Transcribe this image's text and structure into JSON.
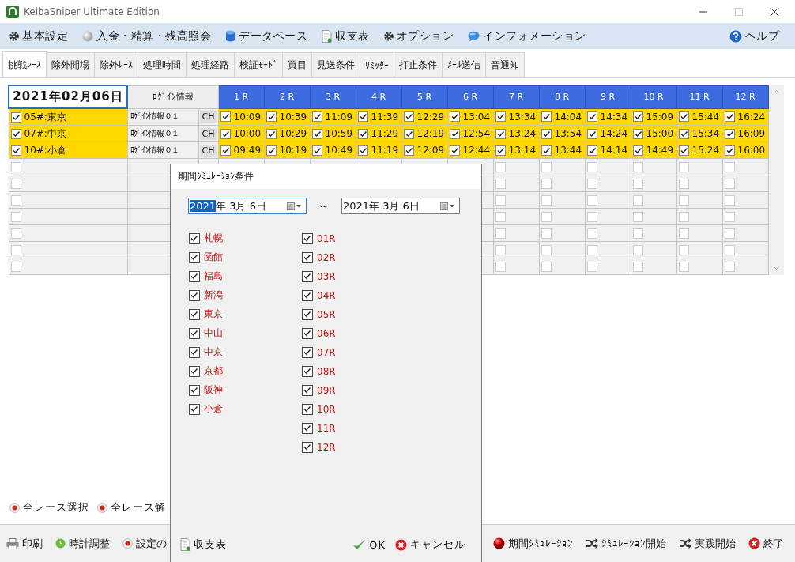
{
  "window": {
    "title": "KeibaSniper Ultimate Edition"
  },
  "menu": [
    {
      "label": "基本設定"
    },
    {
      "label": "入金・精算・残高照会"
    },
    {
      "label": "データベース"
    },
    {
      "label": "収支表"
    },
    {
      "label": "オプション"
    },
    {
      "label": "インフォメーション"
    }
  ],
  "help": {
    "label": "ヘルプ"
  },
  "tabs": [
    {
      "label": "挑戦ﾚｰｽ",
      "selected": true
    },
    {
      "label": "除外開場",
      "selected": false
    },
    {
      "label": "除外ﾚｰｽ",
      "selected": false
    },
    {
      "label": "処理時間",
      "selected": false
    },
    {
      "label": "処理経路",
      "selected": false
    },
    {
      "label": "検証ﾓｰﾄﾞ",
      "selected": false
    },
    {
      "label": "買目",
      "selected": false
    },
    {
      "label": "見送条件",
      "selected": false
    },
    {
      "label": "ﾘﾐｯﾀｰ",
      "selected": false
    },
    {
      "label": "打止条件",
      "selected": false
    },
    {
      "label": "ﾒｰﾙ送信",
      "selected": false
    },
    {
      "label": "音通知",
      "selected": false
    }
  ],
  "grid": {
    "date": "2021年02月06日",
    "login_header": "ﾛｸﾞｲﾝ情報",
    "races": [
      "1 R",
      "2 R",
      "3 R",
      "4 R",
      "5 R",
      "6 R",
      "7 R",
      "8 R",
      "9 R",
      "10 R",
      "11 R",
      "12 R"
    ],
    "rows": [
      {
        "venue": "05#:東京",
        "checked": true,
        "login": "ﾛｸﾞｲﾝ情報０１",
        "ch": "CH",
        "times": [
          {
            "time": "10:09",
            "checked": true
          },
          {
            "time": "10:39",
            "checked": true
          },
          {
            "time": "11:09",
            "checked": true
          },
          {
            "time": "11:39",
            "checked": true
          },
          {
            "time": "12:29",
            "checked": true
          },
          {
            "time": "13:04",
            "checked": true
          },
          {
            "time": "13:34",
            "checked": true
          },
          {
            "time": "14:04",
            "checked": true
          },
          {
            "time": "14:34",
            "checked": true
          },
          {
            "time": "15:09",
            "checked": true
          },
          {
            "time": "15:44",
            "checked": true
          },
          {
            "time": "16:24",
            "checked": true
          }
        ]
      },
      {
        "venue": "07#:中京",
        "checked": true,
        "login": "ﾛｸﾞｲﾝ情報０１",
        "ch": "CH",
        "times": [
          {
            "time": "10:00",
            "checked": true
          },
          {
            "time": "10:29",
            "checked": true
          },
          {
            "time": "10:59",
            "checked": true
          },
          {
            "time": "11:29",
            "checked": true
          },
          {
            "time": "12:19",
            "checked": true
          },
          {
            "time": "12:54",
            "checked": true
          },
          {
            "time": "13:24",
            "checked": true
          },
          {
            "time": "13:54",
            "checked": true
          },
          {
            "time": "14:24",
            "checked": true
          },
          {
            "time": "15:00",
            "checked": true
          },
          {
            "time": "15:34",
            "checked": true
          },
          {
            "time": "16:09",
            "checked": true
          }
        ]
      },
      {
        "venue": "10#:小倉",
        "checked": true,
        "login": "ﾛｸﾞｲﾝ情報０１",
        "ch": "CH",
        "times": [
          {
            "time": "09:49",
            "checked": true
          },
          {
            "time": "10:19",
            "checked": true
          },
          {
            "time": "10:49",
            "checked": true
          },
          {
            "time": "11:19",
            "checked": true
          },
          {
            "time": "12:09",
            "checked": true
          },
          {
            "time": "12:44",
            "checked": true
          },
          {
            "time": "13:14",
            "checked": true
          },
          {
            "time": "13:44",
            "checked": true
          },
          {
            "time": "14:14",
            "checked": true
          },
          {
            "time": "14:49",
            "checked": true
          },
          {
            "time": "15:24",
            "checked": true
          },
          {
            "time": "16:00",
            "checked": true
          }
        ]
      },
      {
        "checked": false,
        "times": [
          {
            "checked": false
          },
          {
            "checked": false
          },
          {
            "checked": false
          },
          {
            "checked": false
          },
          {
            "checked": false
          },
          {
            "checked": false
          }
        ]
      },
      {
        "checked": false,
        "times": [
          {
            "checked": false
          },
          {
            "checked": false
          },
          {
            "checked": false
          },
          {
            "checked": false
          },
          {
            "checked": false
          },
          {
            "checked": false
          }
        ]
      },
      {
        "checked": false,
        "times": [
          {
            "checked": false
          },
          {
            "checked": false
          },
          {
            "checked": false
          },
          {
            "checked": false
          },
          {
            "checked": false
          },
          {
            "checked": false
          }
        ]
      },
      {
        "checked": false,
        "times": [
          {
            "checked": false
          },
          {
            "checked": false
          },
          {
            "checked": false
          },
          {
            "checked": false
          },
          {
            "checked": false
          },
          {
            "checked": false
          }
        ]
      },
      {
        "checked": false,
        "times": [
          {
            "checked": false
          },
          {
            "checked": false
          },
          {
            "checked": false
          },
          {
            "checked": false
          },
          {
            "checked": false
          },
          {
            "checked": false
          }
        ]
      },
      {
        "checked": false,
        "times": [
          {
            "checked": false
          },
          {
            "checked": false
          },
          {
            "checked": false
          },
          {
            "checked": false
          },
          {
            "checked": false
          },
          {
            "checked": false
          }
        ]
      },
      {
        "checked": false,
        "times": [
          {
            "checked": false
          },
          {
            "checked": false
          },
          {
            "checked": false
          },
          {
            "checked": false
          },
          {
            "checked": false
          },
          {
            "checked": false
          }
        ]
      }
    ]
  },
  "select_buttons": [
    "全レース選択",
    "全レース解"
  ],
  "bottom_bar": {
    "left": [
      "印刷",
      "時計調整",
      "設定の"
    ],
    "right": [
      "期間ｼﾐｭﾚｰｼｮﾝ",
      "ｼﾐｭﾚｰｼｮﾝ開始",
      "実践開始",
      "終了"
    ]
  },
  "dialog": {
    "title": "期間ｼﾐｭﾚｰｼｮﾝ条件",
    "from": [
      {
        "text": "2021",
        "selected": true
      },
      {
        "text": "年 3月 6日",
        "selected": false
      }
    ],
    "separator": "～",
    "to": [
      {
        "text": "2021年 3月 6日",
        "selected": false
      }
    ],
    "venues": [
      {
        "label": "札幌",
        "checked": true
      },
      {
        "label": "函館",
        "checked": true
      },
      {
        "label": "福島",
        "checked": true
      },
      {
        "label": "新潟",
        "checked": true
      },
      {
        "label": "東京",
        "checked": true
      },
      {
        "label": "中山",
        "checked": true
      },
      {
        "label": "中京",
        "checked": true
      },
      {
        "label": "京都",
        "checked": true
      },
      {
        "label": "阪神",
        "checked": true
      },
      {
        "label": "小倉",
        "checked": true
      }
    ],
    "races": [
      {
        "label": "01R",
        "checked": true
      },
      {
        "label": "02R",
        "checked": true
      },
      {
        "label": "03R",
        "checked": true
      },
      {
        "label": "04R",
        "checked": true
      },
      {
        "label": "05R",
        "checked": true
      },
      {
        "label": "06R",
        "checked": true
      },
      {
        "label": "07R",
        "checked": true
      },
      {
        "label": "08R",
        "checked": true
      },
      {
        "label": "09R",
        "checked": true
      },
      {
        "label": "10R",
        "checked": true
      },
      {
        "label": "11R",
        "checked": true
      },
      {
        "label": "12R",
        "checked": true
      }
    ],
    "report_button": "収支表",
    "ok_button": "OK",
    "cancel_button": "キャンセル"
  }
}
